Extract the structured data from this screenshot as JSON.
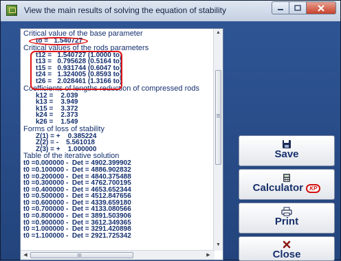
{
  "window": {
    "title": "View the main results of solving the equation of stability"
  },
  "results": {
    "base_heading": "Critical value of the base parameter",
    "to_line": "to =   1.540727",
    "rods_heading": "Critical values of the rods parameters",
    "rods": [
      "t12 =   1.540727 (1.0000 to)",
      "t13 =   0.795628 (0.5164 to)",
      "t15 =   0.931744 (0.6047 to)",
      "t24 =   1.324005 (0.8593 to)",
      "t26 =   2.028461 (1.3166 to)"
    ],
    "coef_heading": "Coefficients of lengths reduction of compressed rods",
    "coefficients": [
      "k12 =    2.039",
      "k13 =    3.949",
      "k15 =    3.372",
      "k24 =    2.373",
      "k26 =    1.549"
    ],
    "forms_heading": "Forms of loss of stability",
    "forms": [
      "Z(1) = +    0.385224",
      "Z(2) = -    5.561018",
      "Z(3) = +    1.000000"
    ],
    "table_heading": "Table of the iterative solution",
    "iterations": [
      "t0 =0.000000 -  Det = 4902.399902",
      "t0 =0.100000 -  Det = 4886.902832",
      "t0 =0.200000 -  Det = 4840.375488",
      "t0 =0.300000 -  Det = 4762.700195",
      "t0 =0.400000 -  Det = 4653.652344",
      "t0 =0.500000 -  Det = 4512.847656",
      "t0 =0.600000 -  Det = 4339.659180",
      "t0 =0.700000 -  Det = 4133.080566",
      "t0 =0.800000 -  Det = 3891.503906",
      "t0 =0.900000 -  Det = 3612.349365",
      "t0 =1.000000 -  Det = 3291.420898",
      "t0 =1.100000 -  Det = 2921.725342"
    ]
  },
  "buttons": {
    "save": "Save",
    "calculator": "Calculator",
    "calculator_badge": "KP",
    "print": "Print",
    "close": "Close"
  },
  "icons": {
    "app": "app-icon",
    "save": "floppy-disk-icon",
    "calculator": "calculator-icon",
    "print": "printer-icon",
    "close": "red-x-icon"
  },
  "colors": {
    "highlight": "#e01212",
    "text": "#14306f",
    "background": "#2c4f8c"
  }
}
